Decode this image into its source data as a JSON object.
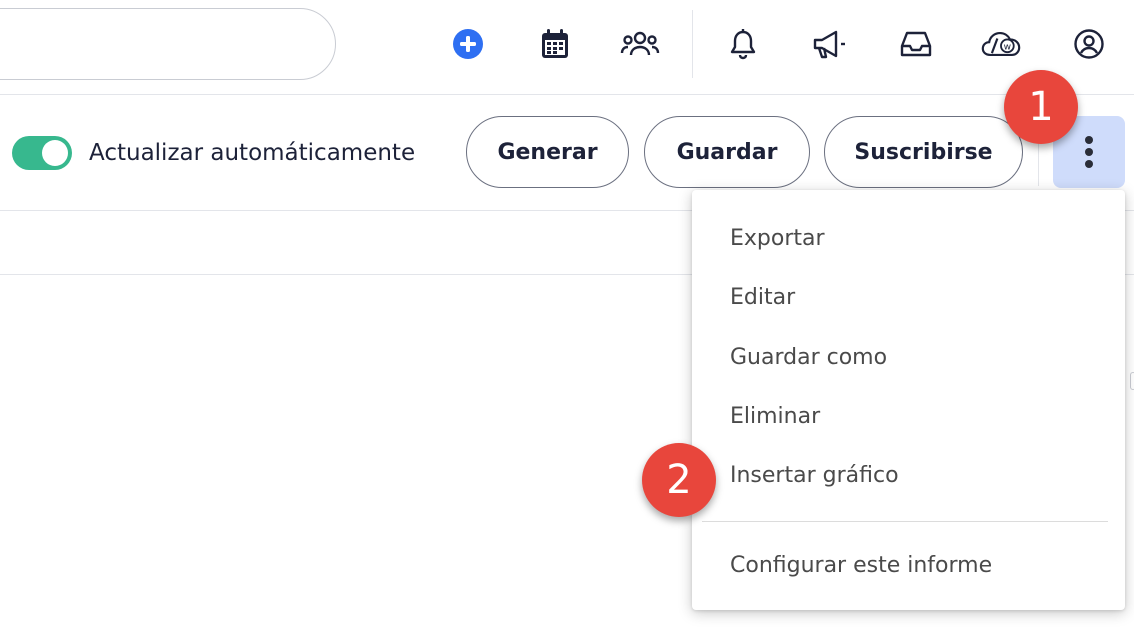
{
  "header": {
    "search": {
      "placeholder": ""
    },
    "icons": [
      {
        "name": "add-icon",
        "color": "#2e6ff2"
      },
      {
        "name": "calendar-icon"
      },
      {
        "name": "team-icon"
      },
      {
        "name": "bell-icon"
      },
      {
        "name": "megaphone-icon"
      },
      {
        "name": "inbox-icon"
      },
      {
        "name": "cloud-w-icon",
        "text": "w"
      },
      {
        "name": "user-account-icon"
      }
    ]
  },
  "toolbar": {
    "auto_update": {
      "label": "Actualizar automáticamente",
      "enabled": true,
      "color": "#37b88e"
    },
    "generate_label": "Generar",
    "save_label": "Guardar",
    "subscribe_label": "Suscribirse",
    "more_icon": "kebab-vertical-icon"
  },
  "menu": {
    "items": [
      {
        "label": "Exportar"
      },
      {
        "label": "Editar"
      },
      {
        "label": "Guardar como"
      },
      {
        "label": "Eliminar"
      },
      {
        "label": "Insertar gráfico"
      },
      {
        "label": "Configurar este informe"
      }
    ]
  },
  "callouts": [
    {
      "label": "1",
      "color": "#e8463c"
    },
    {
      "label": "2",
      "color": "#e8463c"
    }
  ]
}
